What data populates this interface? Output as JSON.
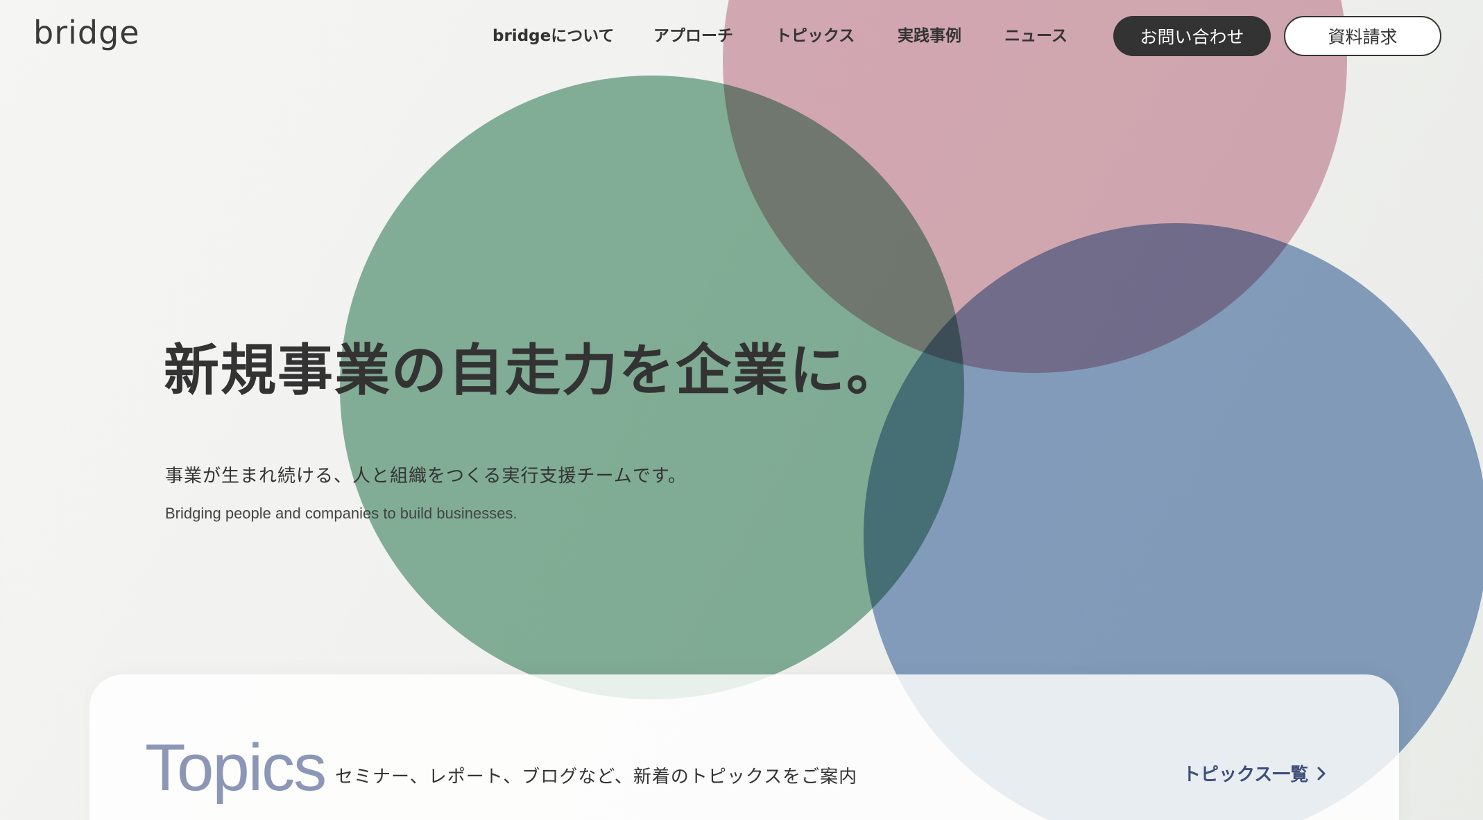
{
  "brand": {
    "logo_text": "bridge"
  },
  "nav": {
    "items": [
      {
        "label": "bridgeについて"
      },
      {
        "label": "アプローチ"
      },
      {
        "label": "トピックス"
      },
      {
        "label": "実践事例"
      },
      {
        "label": "ニュース"
      }
    ],
    "contact_label": "お問い合わせ",
    "docs_label": "資料請求"
  },
  "hero": {
    "headline": "新規事業の自走力を企業に。",
    "subtitle_ja": "事業が生まれ続ける、人と組織をつくる実行支援チームです。",
    "subtitle_en": "Bridging people and companies to build businesses."
  },
  "topics": {
    "title": "Topics",
    "description": "セミナー、レポート、ブログなど、新着のトピックスをご案内",
    "link_label": "トピックス一覧"
  },
  "colors": {
    "green_circle": "#6ea68a",
    "pink_circle": "#d7a0ae",
    "blue_circle": "#7b9ac2",
    "text_dark": "#333333",
    "topics_title": "#8c96b6",
    "topics_link": "#3d4f7a"
  }
}
